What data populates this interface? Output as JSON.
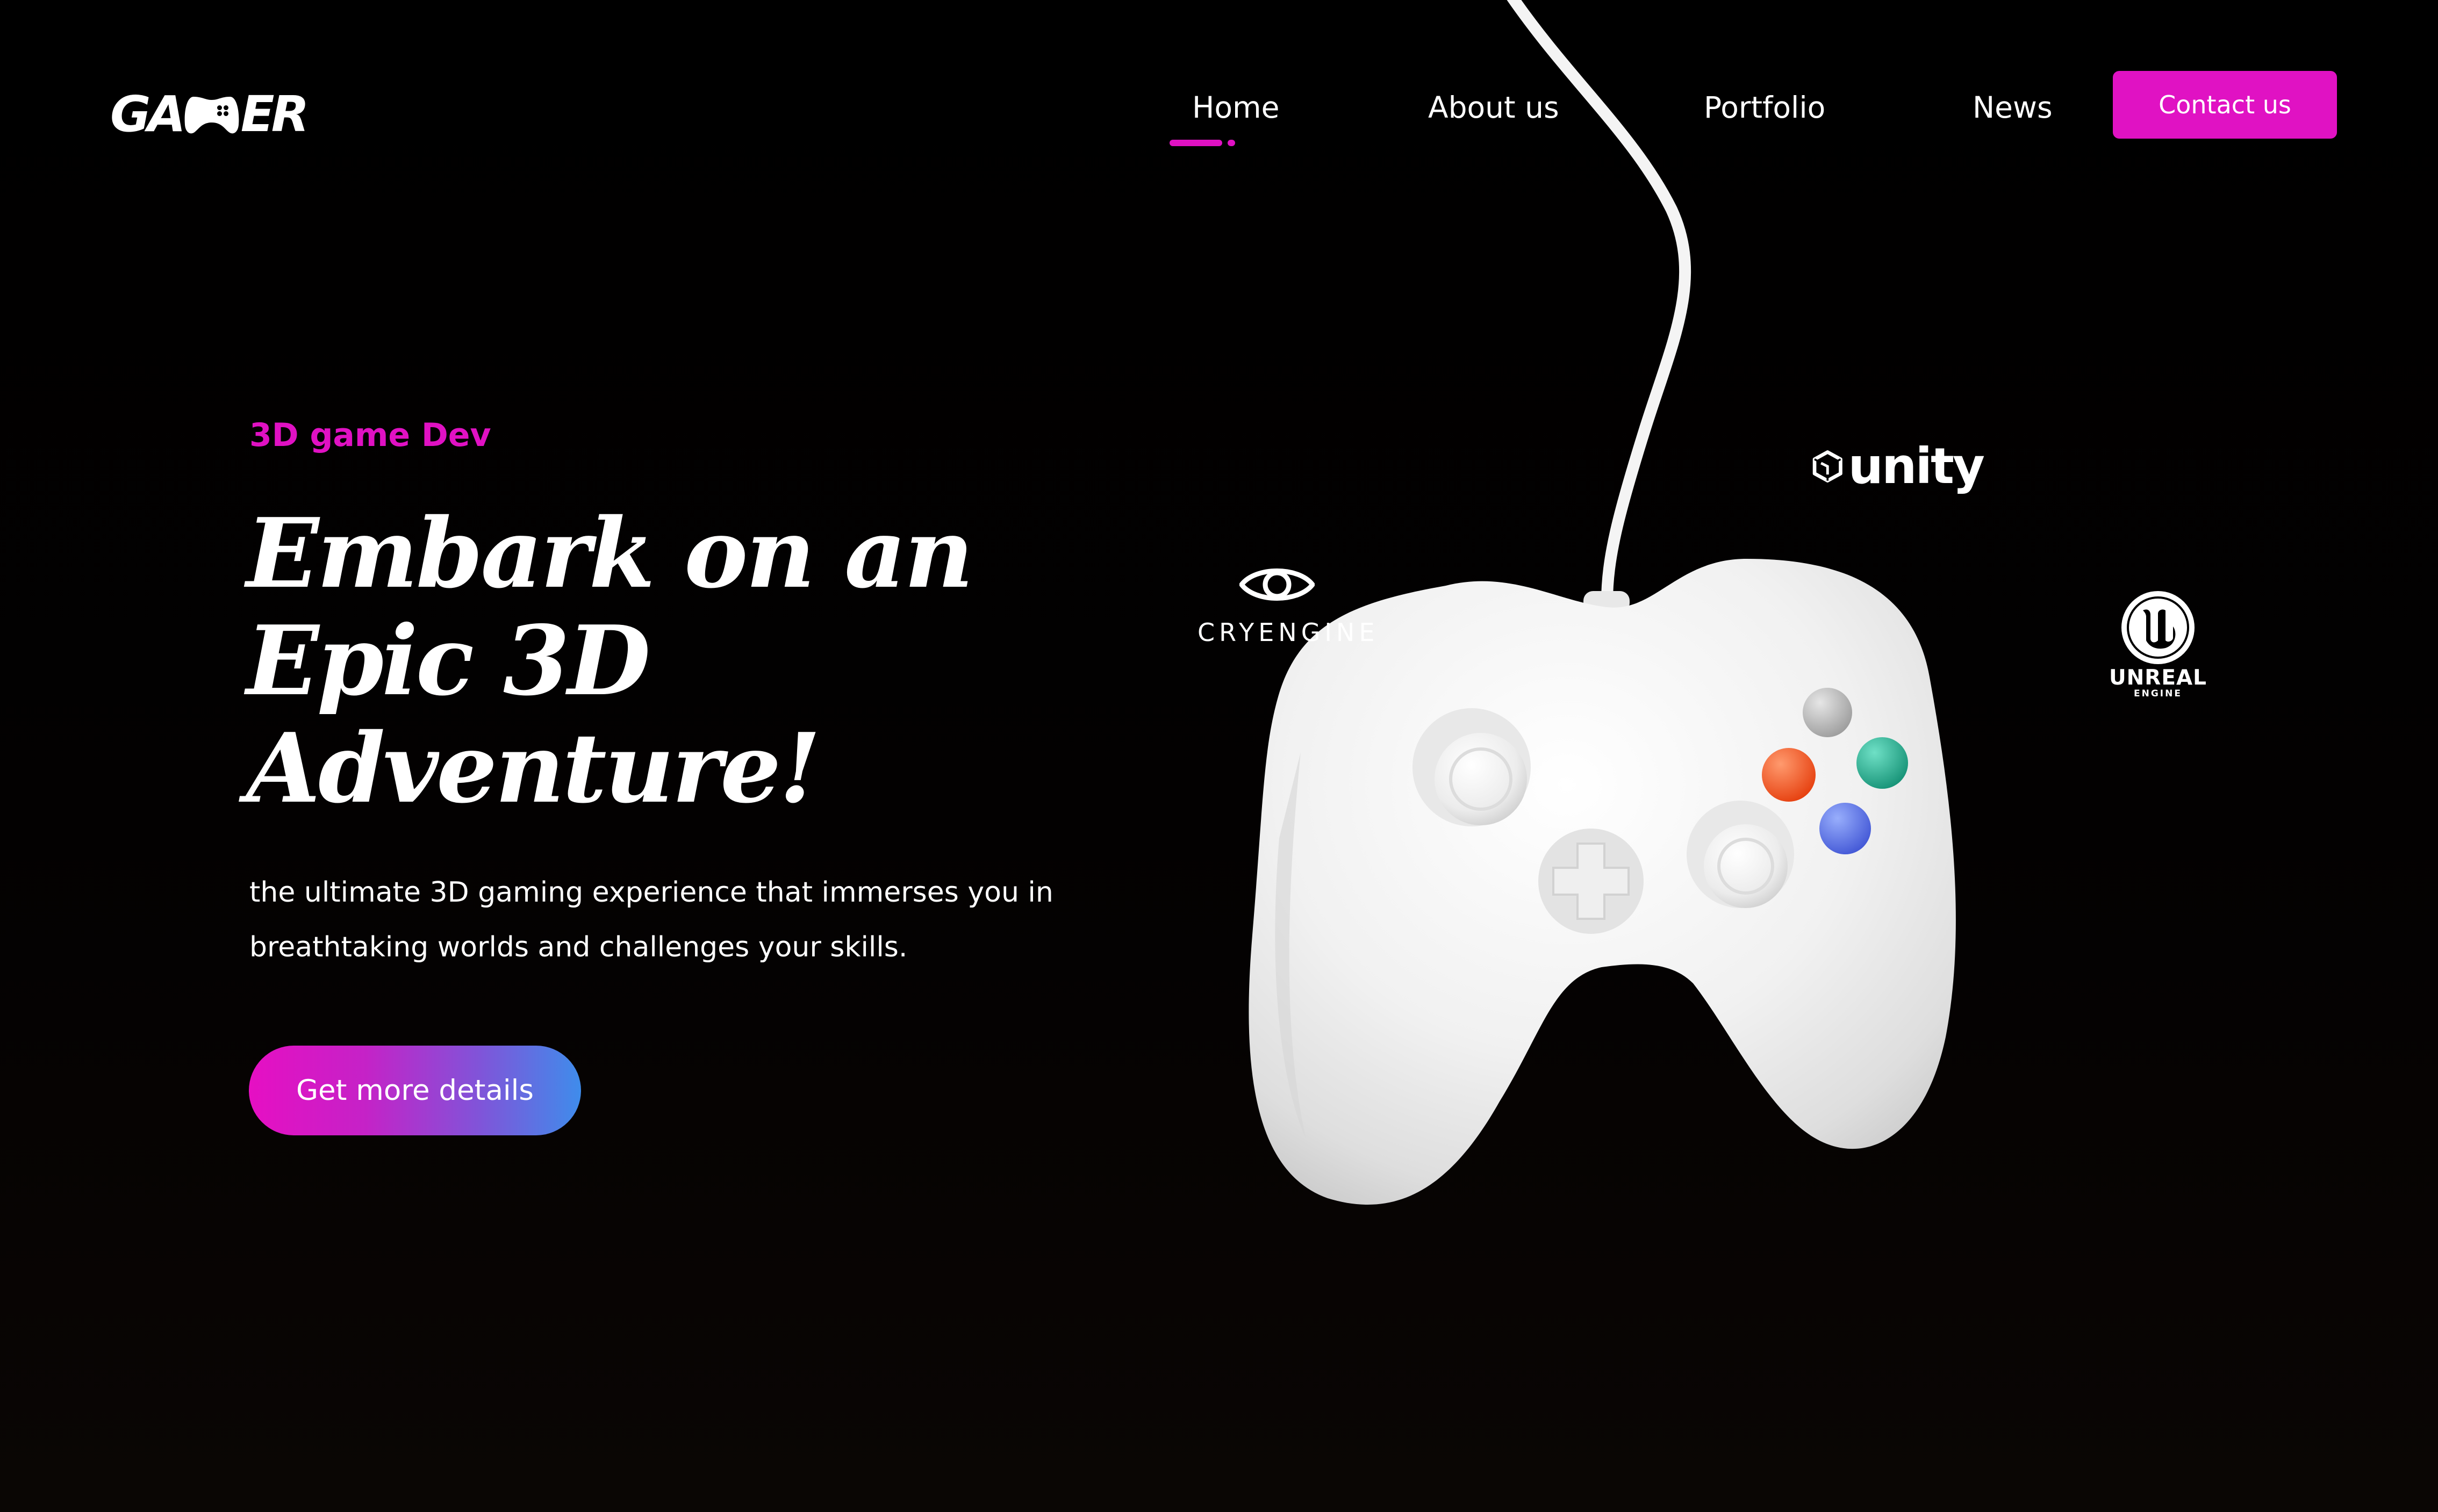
{
  "brand": {
    "logo_text_left": "GA",
    "logo_text_right": "ER",
    "accent_color": "#e011c3"
  },
  "nav": {
    "items": [
      {
        "label": "Home",
        "active": true
      },
      {
        "label": "About us",
        "active": false
      },
      {
        "label": "Portfolio",
        "active": false
      },
      {
        "label": "News",
        "active": false
      }
    ],
    "contact_label": "Contact us"
  },
  "hero": {
    "eyebrow": "3D game Dev",
    "headline_lines": [
      "Embark on an",
      "Epic 3D",
      "Adventure!"
    ],
    "description_lines": [
      "the ultimate 3D gaming experience that immerses you in",
      "breathtaking worlds and challenges your skills."
    ],
    "cta_label": "Get more details"
  },
  "engines": {
    "cryengine": "CRYENGINE",
    "unity": "unity",
    "unreal": "UNREAL",
    "unreal_sub": "ENGINE"
  },
  "art": {
    "object": "white-game-controller",
    "button_colors": [
      "#b5b5b5",
      "#2bb39a",
      "#ff5a2a",
      "#5a78ee"
    ]
  }
}
